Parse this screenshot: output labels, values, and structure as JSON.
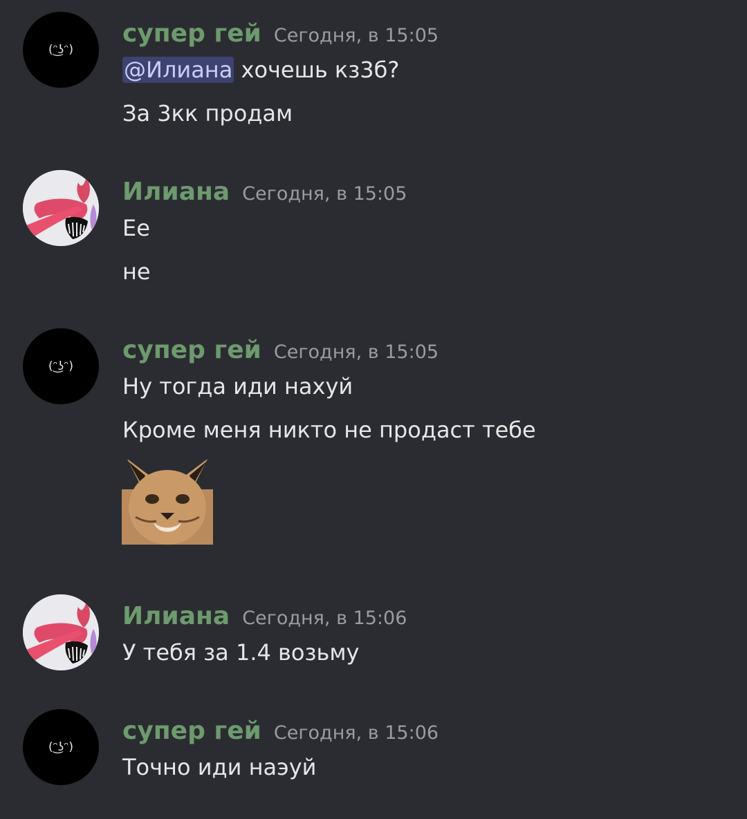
{
  "messages": [
    {
      "author": "супер гей",
      "time": "Сегодня, в 15:05",
      "avatar": "lenny-avatar",
      "avatar_text": "(ᵔ͜ʖᵔ)",
      "lines": [
        {
          "mention": "@Илиана",
          "text": " хочешь кз3б?"
        },
        {
          "text": "За 3кк продам"
        }
      ]
    },
    {
      "author": "Илиана",
      "time": "Сегодня, в 15:05",
      "avatar": "demon-avatar",
      "lines": [
        {
          "text": "Ee"
        },
        {
          "text": "не"
        }
      ]
    },
    {
      "author": "супер гей",
      "time": "Сегодня, в 15:05",
      "avatar": "lenny-avatar",
      "avatar_text": "(ᵔ͜ʖᵔ)",
      "lines": [
        {
          "text": "Ну тогда иди нахуй"
        },
        {
          "text": "Кроме меня никто не продаст тебе"
        }
      ],
      "sticker": "floppa-cat-sticker"
    },
    {
      "author": "Илиана",
      "time": "Сегодня, в 15:06",
      "avatar": "demon-avatar",
      "lines": [
        {
          "text": "У тебя за 1.4 возьму"
        }
      ]
    },
    {
      "author": "супер гей",
      "time": "Сегодня, в 15:06",
      "avatar": "lenny-avatar",
      "avatar_text": "(ᵔ͜ʖᵔ)",
      "lines": [
        {
          "text": "Точно иди наэуй"
        }
      ]
    }
  ],
  "colors": {
    "background": "#2b2c31",
    "username": "#6d9a6e",
    "timestamp": "#9a9ca3",
    "message_text": "#e6e6e8",
    "mention_bg": "#3d4270",
    "mention_text": "#c9cdf7"
  }
}
